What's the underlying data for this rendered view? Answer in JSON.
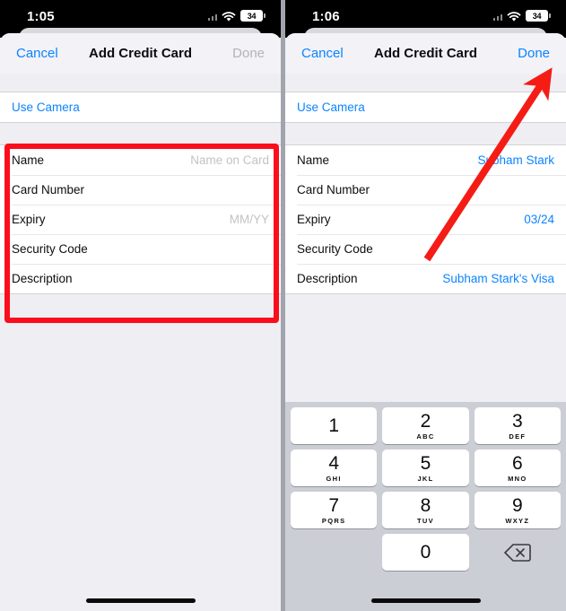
{
  "screens": [
    {
      "id": "empty-form",
      "statusbar": {
        "time": "1:05",
        "cellular_icon": "cellular-signal-icon",
        "wifi_icon": "wifi-icon",
        "battery_level": "34"
      },
      "navbar": {
        "cancel_label": "Cancel",
        "title": "Add Credit Card",
        "done_label": "Done",
        "done_enabled": false
      },
      "camera_row": {
        "label": "Use Camera"
      },
      "fields": [
        {
          "label": "Name",
          "value": "",
          "placeholder": "Name on Card"
        },
        {
          "label": "Card Number",
          "value": "",
          "placeholder": ""
        },
        {
          "label": "Expiry",
          "value": "",
          "placeholder": "MM/YY"
        },
        {
          "label": "Security Code",
          "value": "",
          "placeholder": ""
        },
        {
          "label": "Description",
          "value": "",
          "placeholder": ""
        }
      ],
      "keyboard_visible": false
    },
    {
      "id": "filled-form",
      "statusbar": {
        "time": "1:06",
        "cellular_icon": "cellular-signal-icon",
        "wifi_icon": "wifi-icon",
        "battery_level": "34"
      },
      "navbar": {
        "cancel_label": "Cancel",
        "title": "Add Credit Card",
        "done_label": "Done",
        "done_enabled": true
      },
      "camera_row": {
        "label": "Use Camera"
      },
      "fields": [
        {
          "label": "Name",
          "value": "Subham Stark",
          "placeholder": "Name on Card"
        },
        {
          "label": "Card Number",
          "value": "",
          "placeholder": ""
        },
        {
          "label": "Expiry",
          "value": "03/24",
          "placeholder": "MM/YY"
        },
        {
          "label": "Security Code",
          "value": "",
          "placeholder": ""
        },
        {
          "label": "Description",
          "value": "Subham Stark's Visa",
          "placeholder": ""
        }
      ],
      "keyboard_visible": true
    }
  ],
  "keyboard": {
    "rows": [
      [
        {
          "digit": "1",
          "letters": ""
        },
        {
          "digit": "2",
          "letters": "ABC"
        },
        {
          "digit": "3",
          "letters": "DEF"
        }
      ],
      [
        {
          "digit": "4",
          "letters": "GHI"
        },
        {
          "digit": "5",
          "letters": "JKL"
        },
        {
          "digit": "6",
          "letters": "MNO"
        }
      ],
      [
        {
          "digit": "7",
          "letters": "PQRS"
        },
        {
          "digit": "8",
          "letters": "TUV"
        },
        {
          "digit": "9",
          "letters": "WXYZ"
        }
      ],
      [
        {
          "digit": "",
          "letters": "",
          "type": "blank"
        },
        {
          "digit": "0",
          "letters": ""
        },
        {
          "digit": "",
          "letters": "",
          "type": "delete",
          "icon": "backspace-delete-icon"
        }
      ]
    ]
  },
  "annotations": {
    "highlight_color": "#fc0d1b",
    "arrow_color": "#f41c15",
    "highlight_target": "credit-card-fields-list",
    "arrow_target": "done-button"
  },
  "colors": {
    "accent_blue": "#0b84ff",
    "placeholder_gray": "#c3c3c7",
    "sheet_bg": "#eeeef3",
    "navbar_bg": "#f2f2f7",
    "keyboard_bg": "#ccced5",
    "key_bg": "#ffffff",
    "statusbar_bg": "#000000"
  }
}
